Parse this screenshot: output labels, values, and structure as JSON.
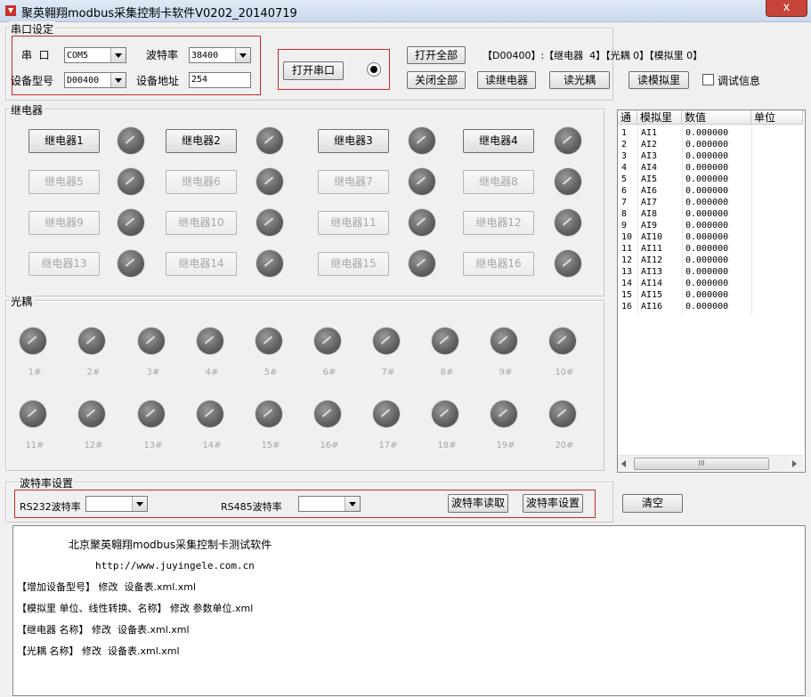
{
  "window": {
    "title": "聚英翱翔modbus采集控制卡软件V0202_20140719",
    "close_symbol": "x"
  },
  "serial": {
    "group_label": "串口设定",
    "port_label": "串  口",
    "port_value": "COM5",
    "baud_label": "波特率",
    "baud_value": "38400",
    "model_label": "设备型号",
    "model_value": "D00400",
    "address_label": "设备地址",
    "address_value": "254",
    "open_button": "打开串口"
  },
  "controls": {
    "open_all": "打开全部",
    "close_all": "关闭全部",
    "read_relay": "读继电器",
    "read_opto": "读光耦",
    "read_analog": "读模拟里",
    "debug_label": "调试信息",
    "status": "【D00400】:【继电器  4】【光耦 0】【模拟里 0】"
  },
  "relays": {
    "group_label": "继电器",
    "items": [
      "继电器1",
      "继电器2",
      "继电器3",
      "继电器4",
      "继电器5",
      "继电器6",
      "继电器7",
      "继电器8",
      "继电器9",
      "继电器10",
      "继电器11",
      "继电器12",
      "继电器13",
      "继电器14",
      "继电器15",
      "继电器16"
    ]
  },
  "optos": {
    "group_label": "光耦",
    "items": [
      "1#",
      "2#",
      "3#",
      "4#",
      "5#",
      "6#",
      "7#",
      "8#",
      "9#",
      "10#",
      "11#",
      "12#",
      "13#",
      "14#",
      "15#",
      "16#",
      "17#",
      "18#",
      "19#",
      "20#"
    ]
  },
  "analog_table": {
    "headers": [
      "通",
      "模拟里",
      "数值",
      "单位"
    ],
    "rows": [
      [
        "1",
        "AI1",
        "0.000000"
      ],
      [
        "2",
        "AI2",
        "0.000000"
      ],
      [
        "3",
        "AI3",
        "0.000000"
      ],
      [
        "4",
        "AI4",
        "0.000000"
      ],
      [
        "5",
        "AI5",
        "0.000000"
      ],
      [
        "6",
        "AI6",
        "0.000000"
      ],
      [
        "7",
        "AI7",
        "0.000000"
      ],
      [
        "8",
        "AI8",
        "0.000000"
      ],
      [
        "9",
        "AI9",
        "0.000000"
      ],
      [
        "10",
        "AI10",
        "0.000000"
      ],
      [
        "11",
        "AI11",
        "0.000000"
      ],
      [
        "12",
        "AI12",
        "0.000000"
      ],
      [
        "13",
        "AI13",
        "0.000000"
      ],
      [
        "14",
        "AI14",
        "0.000000"
      ],
      [
        "15",
        "AI15",
        "0.000000"
      ],
      [
        "16",
        "AI16",
        "0.000000"
      ]
    ],
    "scroll_thumb": "III"
  },
  "baud_settings": {
    "group_label": "波特率设置",
    "rs232_label": "RS232波特率",
    "rs232_value": "",
    "rs485_label": "RS485波特率",
    "rs485_value": "",
    "read_button": "波特率读取",
    "set_button": "波特率设置"
  },
  "clear_button": "清空",
  "log": {
    "lines": [
      "北京聚英翱翔modbus采集控制卡测试软件",
      "http://www.juyingele.com.cn",
      "【增加设备型号】 修改  设备表.xml.xml",
      "【模拟里 单位、线性转换、名称】 修改 参数单位.xml",
      "【继电器 名称】 修改  设备表.xml.xml",
      "【光耦 名称】 修改  设备表.xml.xml"
    ]
  }
}
